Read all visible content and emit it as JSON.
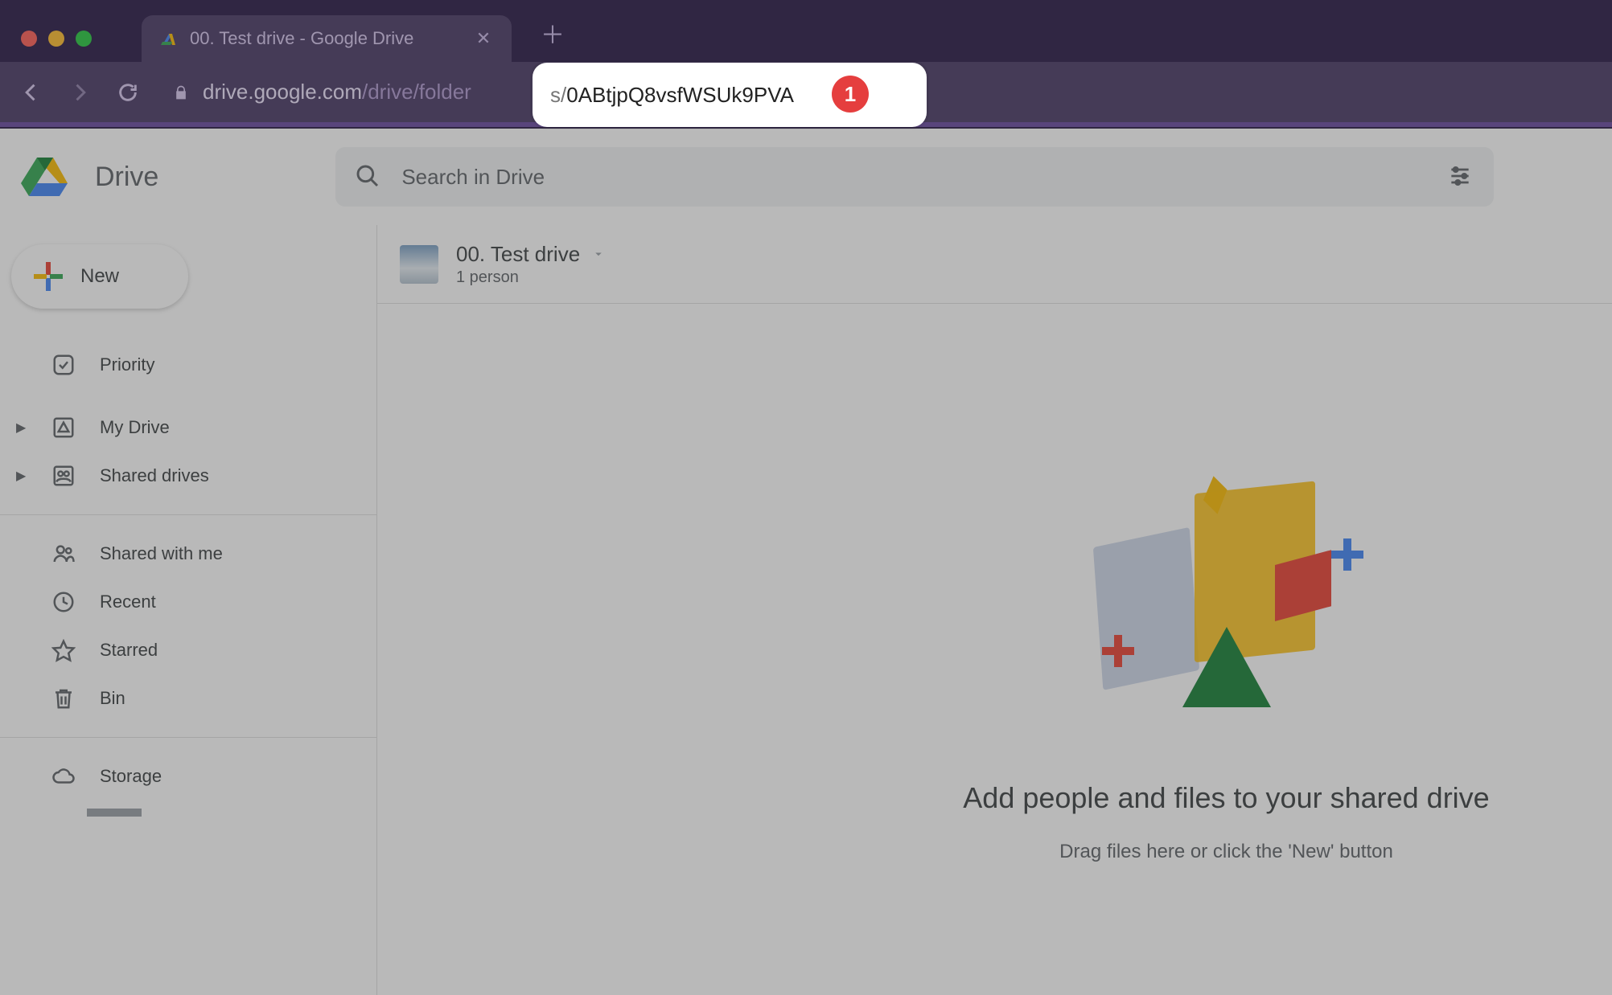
{
  "browser": {
    "tab": {
      "title": "00. Test drive - Google Drive"
    },
    "url": {
      "scheme_lock": true,
      "domain": "drive.google.com",
      "path_dim": "/drive/folder",
      "highlight_prefix": "s/",
      "highlight_id": "0ABtjpQ8vsfWSUk9PVA"
    },
    "annotation_badge": "1"
  },
  "app": {
    "product": "Drive",
    "search_placeholder": "Search in Drive",
    "new_button": "New",
    "sidebar": {
      "priority": "Priority",
      "my_drive": "My Drive",
      "shared_drives": "Shared drives",
      "shared_with_me": "Shared with me",
      "recent": "Recent",
      "starred": "Starred",
      "bin": "Bin",
      "storage": "Storage"
    },
    "breadcrumb": {
      "title": "00. Test drive",
      "subtitle": "1 person"
    },
    "empty_state": {
      "title": "Add people and files to your shared drive",
      "subtitle": "Drag files here or click the 'New' button"
    }
  }
}
